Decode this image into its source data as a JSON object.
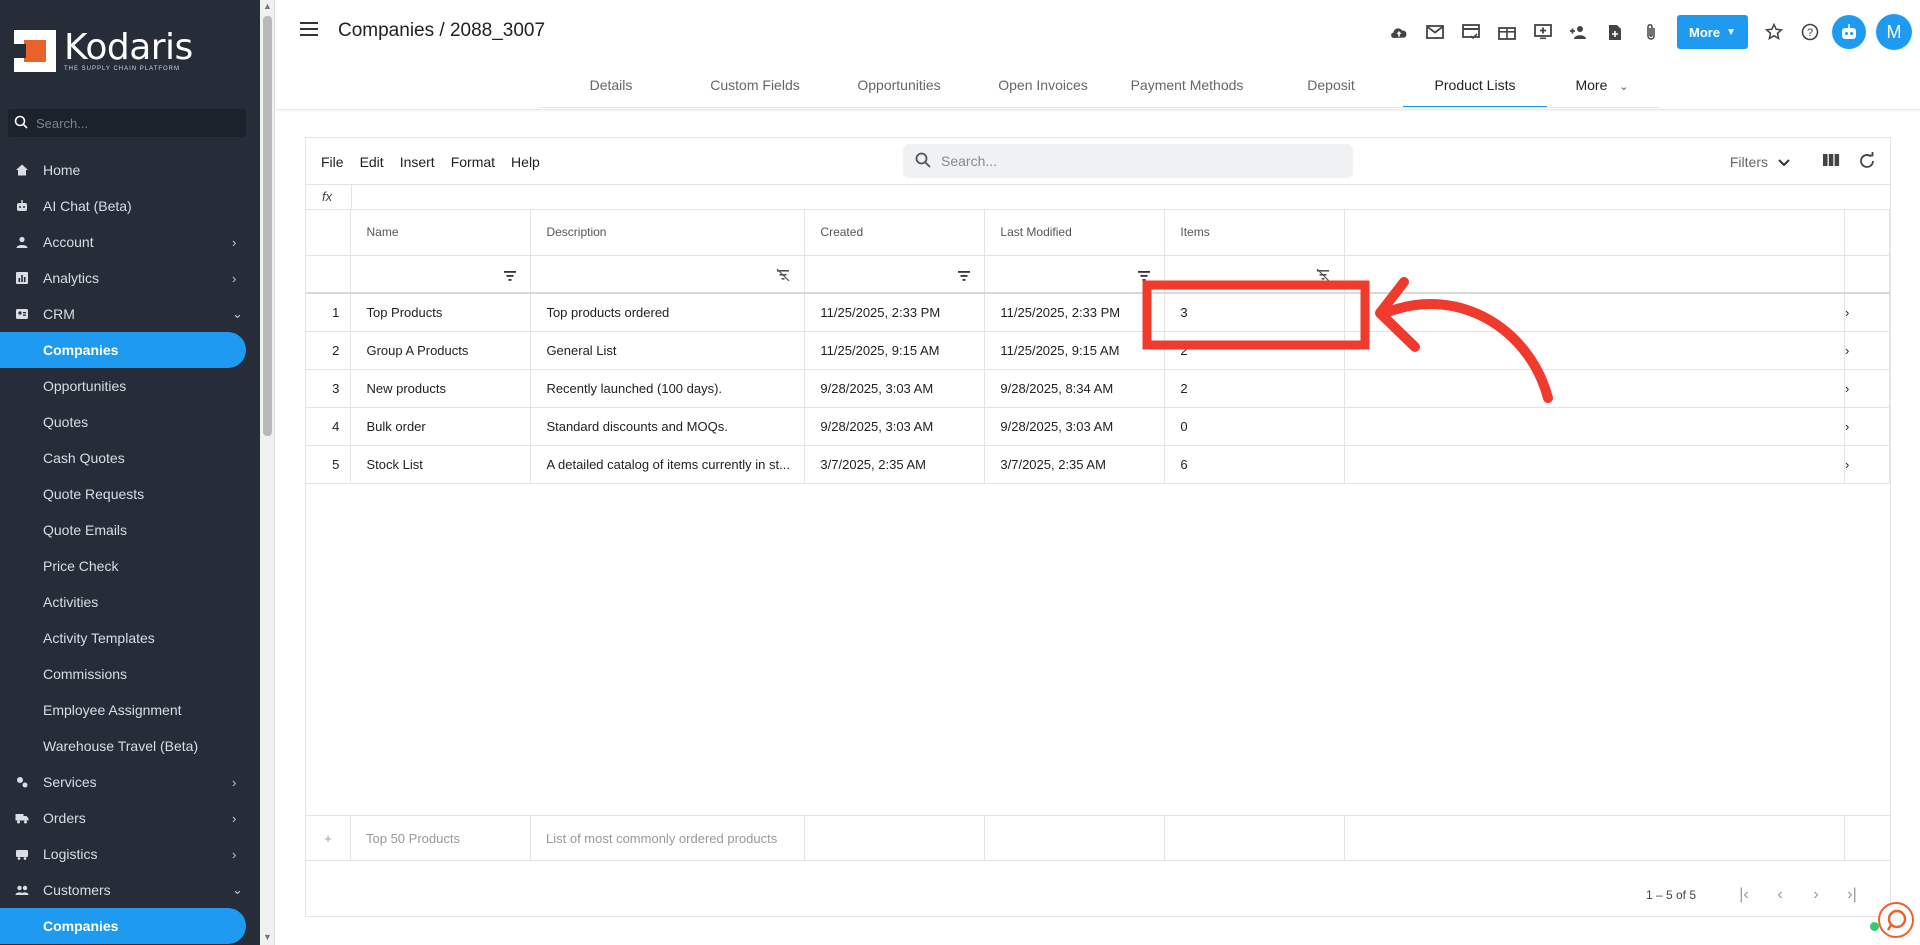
{
  "brand": {
    "name": "Kodaris",
    "tagline": "THE SUPPLY CHAIN PLATFORM",
    "accent": "#1e9bf0",
    "annotation_color": "#f03a2e"
  },
  "sidebar": {
    "search_placeholder": "Search...",
    "items": [
      {
        "label": "Home",
        "icon": "home-icon"
      },
      {
        "label": "AI Chat (Beta)",
        "icon": "robot-icon"
      },
      {
        "label": "Account",
        "icon": "person-icon",
        "chevron": "›"
      },
      {
        "label": "Analytics",
        "icon": "chart-icon",
        "chevron": "›"
      },
      {
        "label": "CRM",
        "icon": "contacts-icon",
        "chevron": "⌄"
      },
      {
        "label": "Companies",
        "active": true
      },
      {
        "label": "Opportunities"
      },
      {
        "label": "Quotes"
      },
      {
        "label": "Cash Quotes"
      },
      {
        "label": "Quote Requests"
      },
      {
        "label": "Quote Emails"
      },
      {
        "label": "Price Check"
      },
      {
        "label": "Activities"
      },
      {
        "label": "Activity Templates"
      },
      {
        "label": "Commissions"
      },
      {
        "label": "Employee Assignment"
      },
      {
        "label": "Warehouse Travel (Beta)"
      },
      {
        "label": "Services",
        "icon": "services-icon",
        "chevron": "›"
      },
      {
        "label": "Orders",
        "icon": "truck-icon",
        "chevron": "›"
      },
      {
        "label": "Logistics",
        "icon": "logistics-icon",
        "chevron": "›"
      },
      {
        "label": "Customers",
        "icon": "people-icon",
        "chevron": "⌄"
      },
      {
        "label": "Companies",
        "active": true
      }
    ]
  },
  "header": {
    "title": "Companies / 2088_3007",
    "more_label": "More",
    "avatar_initial": "M",
    "tabs": [
      "Details",
      "Custom Fields",
      "Opportunities",
      "Open Invoices",
      "Payment Methods",
      "Deposit",
      "Product Lists"
    ],
    "active_tab": "Product Lists",
    "tabs_more": "More"
  },
  "grid": {
    "menu": [
      "File",
      "Edit",
      "Insert",
      "Format",
      "Help"
    ],
    "search_placeholder": "Search...",
    "filters_label": "Filters",
    "fx_label": "fx",
    "columns": [
      "Name",
      "Description",
      "Created",
      "Last Modified",
      "Items"
    ],
    "rows": [
      {
        "num": "1",
        "name": "Top Products",
        "description": "Top products ordered",
        "created": "11/25/2025, 2:33 PM",
        "modified": "11/25/2025, 2:33 PM",
        "items": "3"
      },
      {
        "num": "2",
        "name": "Group A Products",
        "description": "General List",
        "created": "11/25/2025, 9:15 AM",
        "modified": "11/25/2025, 9:15 AM",
        "items": "2"
      },
      {
        "num": "3",
        "name": "New products",
        "description": "Recently launched (100 days).",
        "created": "9/28/2025, 3:03 AM",
        "modified": "9/28/2025, 8:34 AM",
        "items": "2"
      },
      {
        "num": "4",
        "name": "Bulk order",
        "description": "Standard discounts and MOQs.",
        "created": "9/28/2025, 3:03 AM",
        "modified": "9/28/2025, 3:03 AM",
        "items": "0"
      },
      {
        "num": "5",
        "name": "Stock List",
        "description": "A detailed catalog of items currently in st...",
        "created": "3/7/2025, 2:35 AM",
        "modified": "3/7/2025, 2:35 AM",
        "items": "6"
      }
    ],
    "new_row": {
      "name_placeholder": "Top 50 Products",
      "description_placeholder": "List of most commonly ordered products"
    },
    "pager": {
      "count": "1 – 5 of 5"
    }
  }
}
